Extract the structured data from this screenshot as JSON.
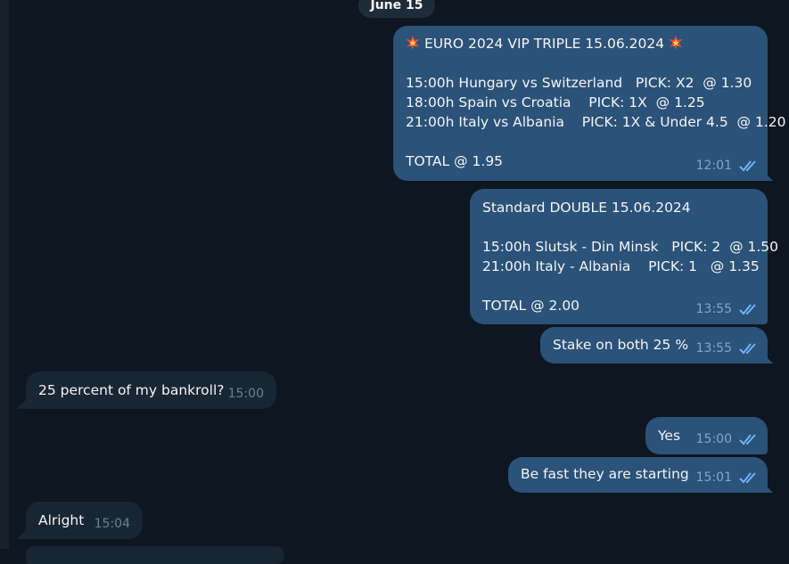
{
  "date_label": "June 15",
  "messages": [
    {
      "lines": [
        "EURO 2024 VIP TRIPLE 15.06.2024",
        "",
        "15:00h Hungary vs Switzerland   PICK: X2  @ 1.30",
        "18:00h Spain vs Croatia    PICK: 1X  @ 1.25",
        "21:00h Italy vs Albania    PICK: 1X & Under 4.5  @ 1.20",
        "",
        "TOTAL @ 1.95"
      ],
      "time": "12:01",
      "status_icon": "double-check-icon"
    },
    {
      "lines": [
        "Standard DOUBLE 15.06.2024",
        "",
        "15:00h Slutsk - Din Minsk   PICK: 2  @ 1.50",
        "21:00h Italy - Albania    PICK: 1   @ 1.35",
        "",
        "TOTAL @ 2.00"
      ],
      "time": "13:55",
      "status_icon": "double-check-icon"
    },
    {
      "text": "Stake on both 25 %",
      "time": "13:55",
      "status_icon": "double-check-icon"
    },
    {
      "text": "25 percent of my bankroll?",
      "time": "15:00"
    },
    {
      "text": "Yes",
      "time": "15:00",
      "status_icon": "double-check-icon"
    },
    {
      "text": "Be fast they are starting",
      "time": "15:01",
      "status_icon": "double-check-icon"
    },
    {
      "text": "Alright",
      "time": "15:04"
    }
  ],
  "colors": {
    "background": "#0e1621",
    "outgoing_bubble": "#2b5278",
    "incoming_bubble": "#182533",
    "outgoing_meta": "#7da8d3",
    "check": "#6cb5f9"
  }
}
